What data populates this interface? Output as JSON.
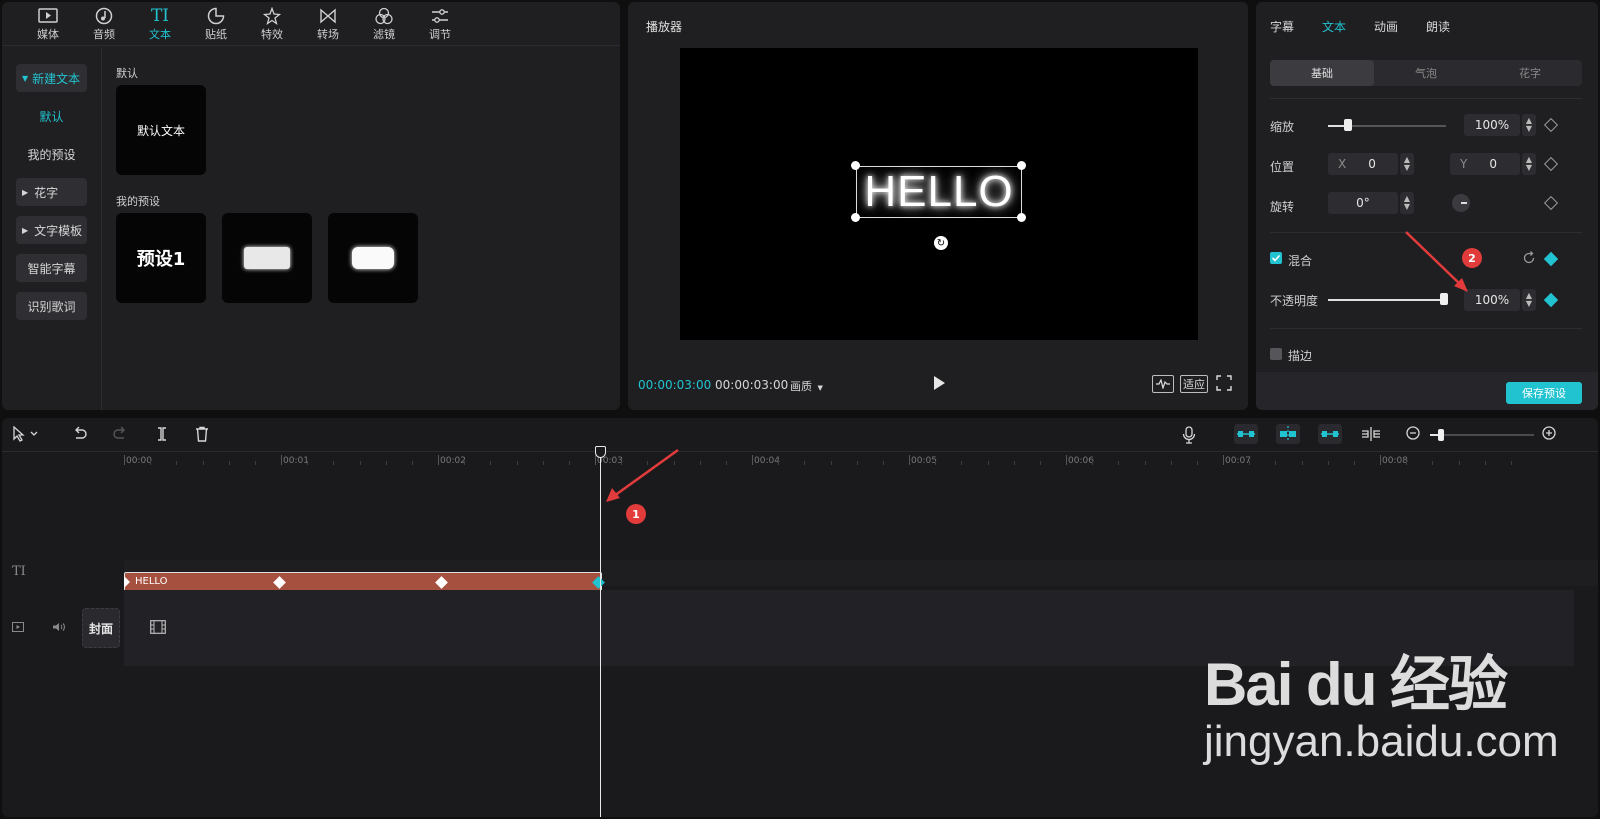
{
  "media": {
    "tabs": [
      {
        "label": "媒体",
        "icon": "media-icon"
      },
      {
        "label": "音频",
        "icon": "audio-icon"
      },
      {
        "label": "文本",
        "icon": "text-icon",
        "active": true
      },
      {
        "label": "贴纸",
        "icon": "sticker-icon"
      },
      {
        "label": "特效",
        "icon": "effects-icon"
      },
      {
        "label": "转场",
        "icon": "transition-icon"
      },
      {
        "label": "滤镜",
        "icon": "filter-icon"
      },
      {
        "label": "调节",
        "icon": "adjust-icon"
      }
    ],
    "nav": {
      "new_text": "新建文本",
      "default": "默认",
      "my_presets": "我的预设",
      "fancy": "花字",
      "templates": "文字模板",
      "smart_captions": "智能字幕",
      "lyrics": "识别歌词"
    },
    "sections": {
      "default_label": "默认",
      "default_card": "默认文本",
      "presets_label": "我的预设",
      "preset1": "预设1"
    }
  },
  "player": {
    "title": "播放器",
    "preview_text": "HELLO",
    "current_time": "00:00:03:00",
    "total_time": "00:00:03:00",
    "quality": "画质",
    "fit": "适应"
  },
  "inspector": {
    "tabs": [
      "字幕",
      "文本",
      "动画",
      "朗读"
    ],
    "active_tab": "文本",
    "segments": [
      "基础",
      "气泡",
      "花字"
    ],
    "scale_label": "缩放",
    "scale_value": "100%",
    "position_label": "位置",
    "pos_x_label": "X",
    "pos_x": "0",
    "pos_y_label": "Y",
    "pos_y": "0",
    "rotation_label": "旋转",
    "rotation": "0°",
    "blend_label": "混合",
    "opacity_label": "不透明度",
    "opacity_value": "100%",
    "stroke_label": "描边",
    "save_preset": "保存预设",
    "scale_level": 0.15,
    "opacity_level": 1.0
  },
  "timeline": {
    "ticks": [
      "00:00",
      "00:01",
      "00:02",
      "00:03",
      "00:04",
      "00:05",
      "00:06",
      "00:07",
      "00:08"
    ],
    "clip_label": "HELLO",
    "cover_label": "封面",
    "track_icon": "TI"
  },
  "annotations": {
    "badge1": "1",
    "badge2": "2"
  },
  "watermark": {
    "main": "Bai du 经验",
    "url": "jingyan.baidu.com"
  },
  "colors": {
    "accent": "#22c3d0",
    "clip": "#a65140",
    "badge": "#e23b3b"
  }
}
